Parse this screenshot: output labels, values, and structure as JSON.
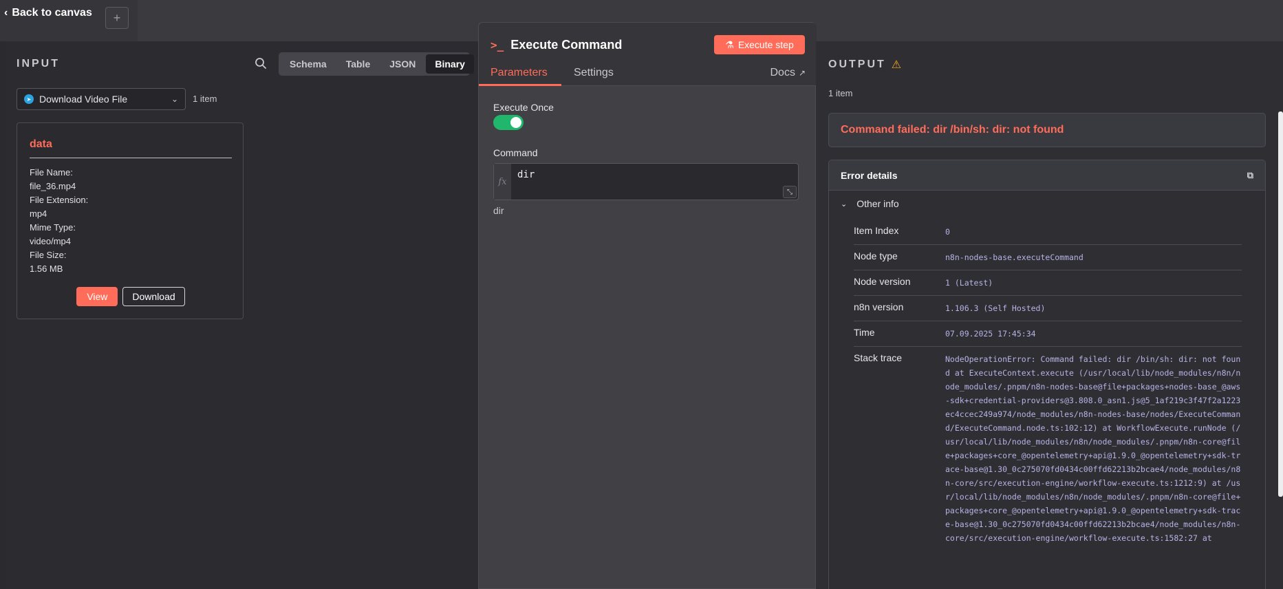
{
  "topbar": {
    "back_label": "Back to canvas",
    "plus_label": "+"
  },
  "input": {
    "title": "INPUT",
    "view_tabs": [
      "Schema",
      "Table",
      "JSON",
      "Binary"
    ],
    "active_tab": "Binary",
    "node_name": "Download Video File",
    "item_count": "1 item",
    "binary": {
      "title": "data",
      "fields": [
        {
          "label": "File Name:",
          "value": "file_36.mp4"
        },
        {
          "label": "File Extension:",
          "value": "mp4"
        },
        {
          "label": "Mime Type:",
          "value": "video/mp4"
        },
        {
          "label": "File Size:",
          "value": "1.56 MB"
        }
      ],
      "view_label": "View",
      "download_label": "Download"
    }
  },
  "node": {
    "title": "Execute Command",
    "execute_label": "Execute step",
    "tabs": {
      "parameters": "Parameters",
      "settings": "Settings",
      "docs": "Docs"
    },
    "execute_once_label": "Execute Once",
    "execute_once": true,
    "command_label": "Command",
    "command_value": "dir",
    "command_preview": "dir"
  },
  "output": {
    "title": "OUTPUT",
    "item_count": "1 item",
    "error_message": "Command failed: dir /bin/sh: dir: not found",
    "error_details_label": "Error details",
    "other_info_label": "Other info",
    "rows": [
      {
        "key": "Item Index",
        "value": "0"
      },
      {
        "key": "Node type",
        "value": "n8n-nodes-base.executeCommand"
      },
      {
        "key": "Node version",
        "value": "1 (Latest)"
      },
      {
        "key": "n8n version",
        "value": "1.106.3 (Self Hosted)"
      },
      {
        "key": "Time",
        "value": "07.09.2025 17:45:34"
      }
    ],
    "stack_label": "Stack trace",
    "stack_trace": "NodeOperationError: Command failed: dir /bin/sh: dir: not found at ExecuteContext.execute (/usr/local/lib/node_modules/n8n/node_modules/.pnpm/n8n-nodes-base@file+packages+nodes-base_@aws-sdk+credential-providers@3.808.0_asn1.js@5_1af219c3f47f2a1223ec4ccec249a974/node_modules/n8n-nodes-base/nodes/ExecuteCommand/ExecuteCommand.node.ts:102:12) at WorkflowExecute.runNode (/usr/local/lib/node_modules/n8n/node_modules/.pnpm/n8n-core@file+packages+core_@opentelemetry+api@1.9.0_@opentelemetry+sdk-trace-base@1.30_0c275070fd0434c00ffd62213b2bcae4/node_modules/n8n-core/src/execution-engine/workflow-execute.ts:1212:9) at /usr/local/lib/node_modules/n8n/node_modules/.pnpm/n8n-core@file+packages+core_@opentelemetry+api@1.9.0_@opentelemetry+sdk-trace-base@1.30_0c275070fd0434c00ffd62213b2bcae4/node_modules/n8n-core/src/execution-engine/workflow-execute.ts:1582:27 at"
  }
}
